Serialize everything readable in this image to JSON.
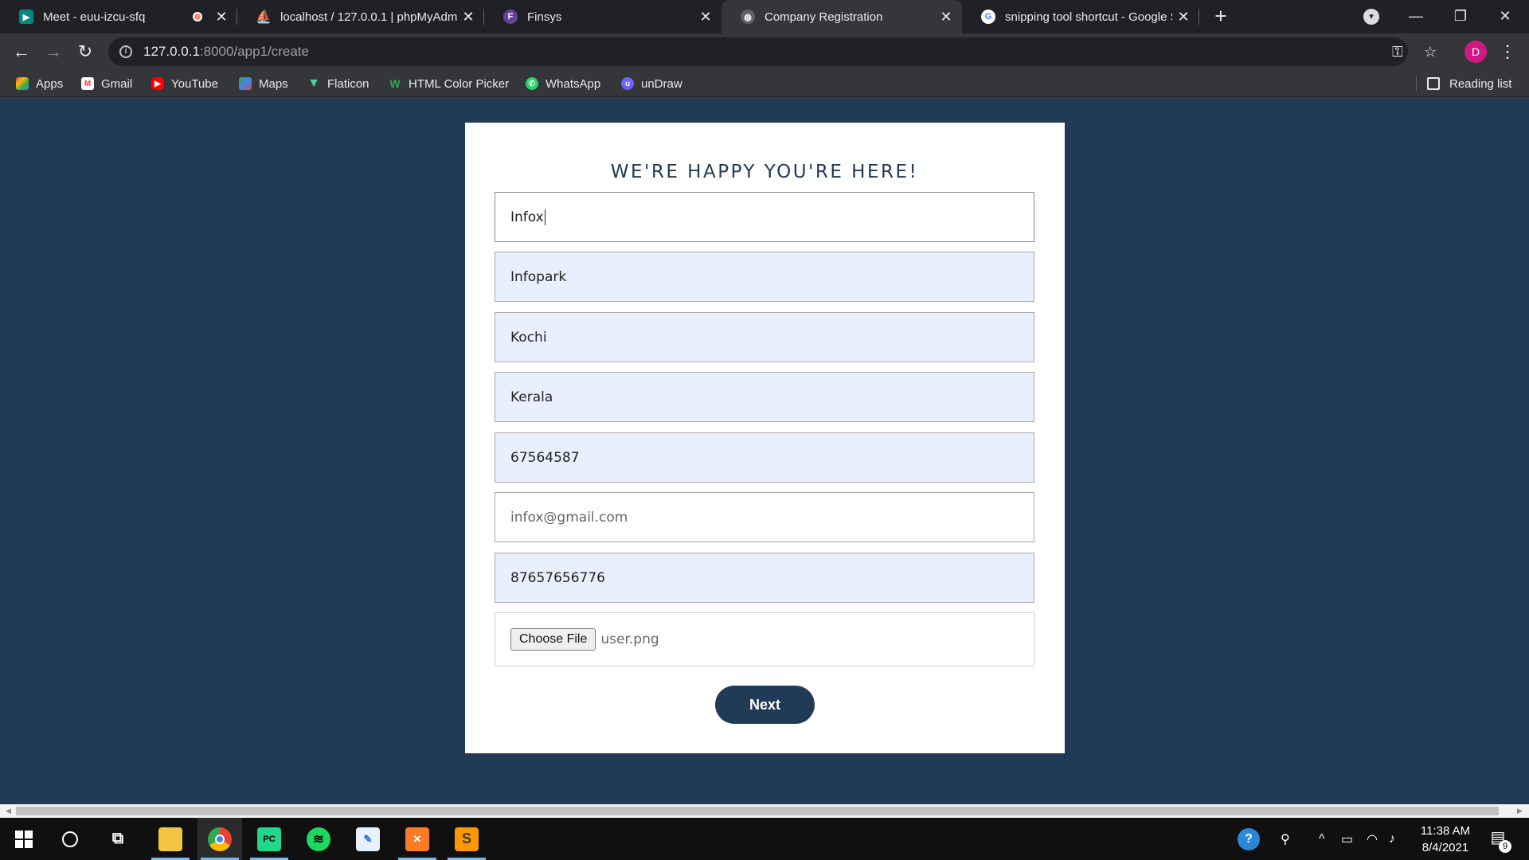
{
  "browser": {
    "tabs": [
      {
        "title": "Meet - euu-izcu-sfq",
        "icon": "google-meet-icon",
        "recording": true
      },
      {
        "title": "localhost / 127.0.0.1 | phpMyAdmin",
        "icon": "phpmyadmin-icon"
      },
      {
        "title": "Finsys",
        "icon": "finsys-icon"
      },
      {
        "title": "Company Registration",
        "icon": "globe-icon",
        "active": true
      },
      {
        "title": "snipping tool shortcut - Google Search",
        "icon": "google-icon"
      }
    ],
    "address": {
      "host": "127.0.0.1",
      "path": ":8000/app1/create"
    },
    "profile_initial": "D",
    "bookmarks": [
      {
        "label": "Apps",
        "icon": "apps-grid-icon"
      },
      {
        "label": "Gmail",
        "icon": "gmail-icon"
      },
      {
        "label": "YouTube",
        "icon": "youtube-icon"
      },
      {
        "label": "Maps",
        "icon": "maps-icon"
      },
      {
        "label": "Flaticon",
        "icon": "flaticon-icon"
      },
      {
        "label": "HTML Color Picker",
        "icon": "html-color-picker-icon"
      },
      {
        "label": "WhatsApp",
        "icon": "whatsapp-icon"
      },
      {
        "label": "unDraw",
        "icon": "undraw-icon"
      }
    ],
    "reading_list": "Reading list"
  },
  "form": {
    "heading": "WE'RE HAPPY YOU'RE HERE!",
    "fields": [
      {
        "value": "Infox",
        "focused": true
      },
      {
        "value": "Infopark"
      },
      {
        "value": "Kochi"
      },
      {
        "value": "Kerala"
      },
      {
        "value": "67564587"
      },
      {
        "value": "infox@gmail.com"
      },
      {
        "value": "87657656776"
      }
    ],
    "file": {
      "button": "Choose File",
      "filename": "user.png"
    },
    "submit": "Next"
  },
  "taskbar": {
    "time": "11:38 AM",
    "date": "8/4/2021",
    "notifications": "9"
  },
  "colors": {
    "page_bg": "#213a55",
    "autofill_bg": "#e8f0fe",
    "button_bg": "#213a55"
  }
}
